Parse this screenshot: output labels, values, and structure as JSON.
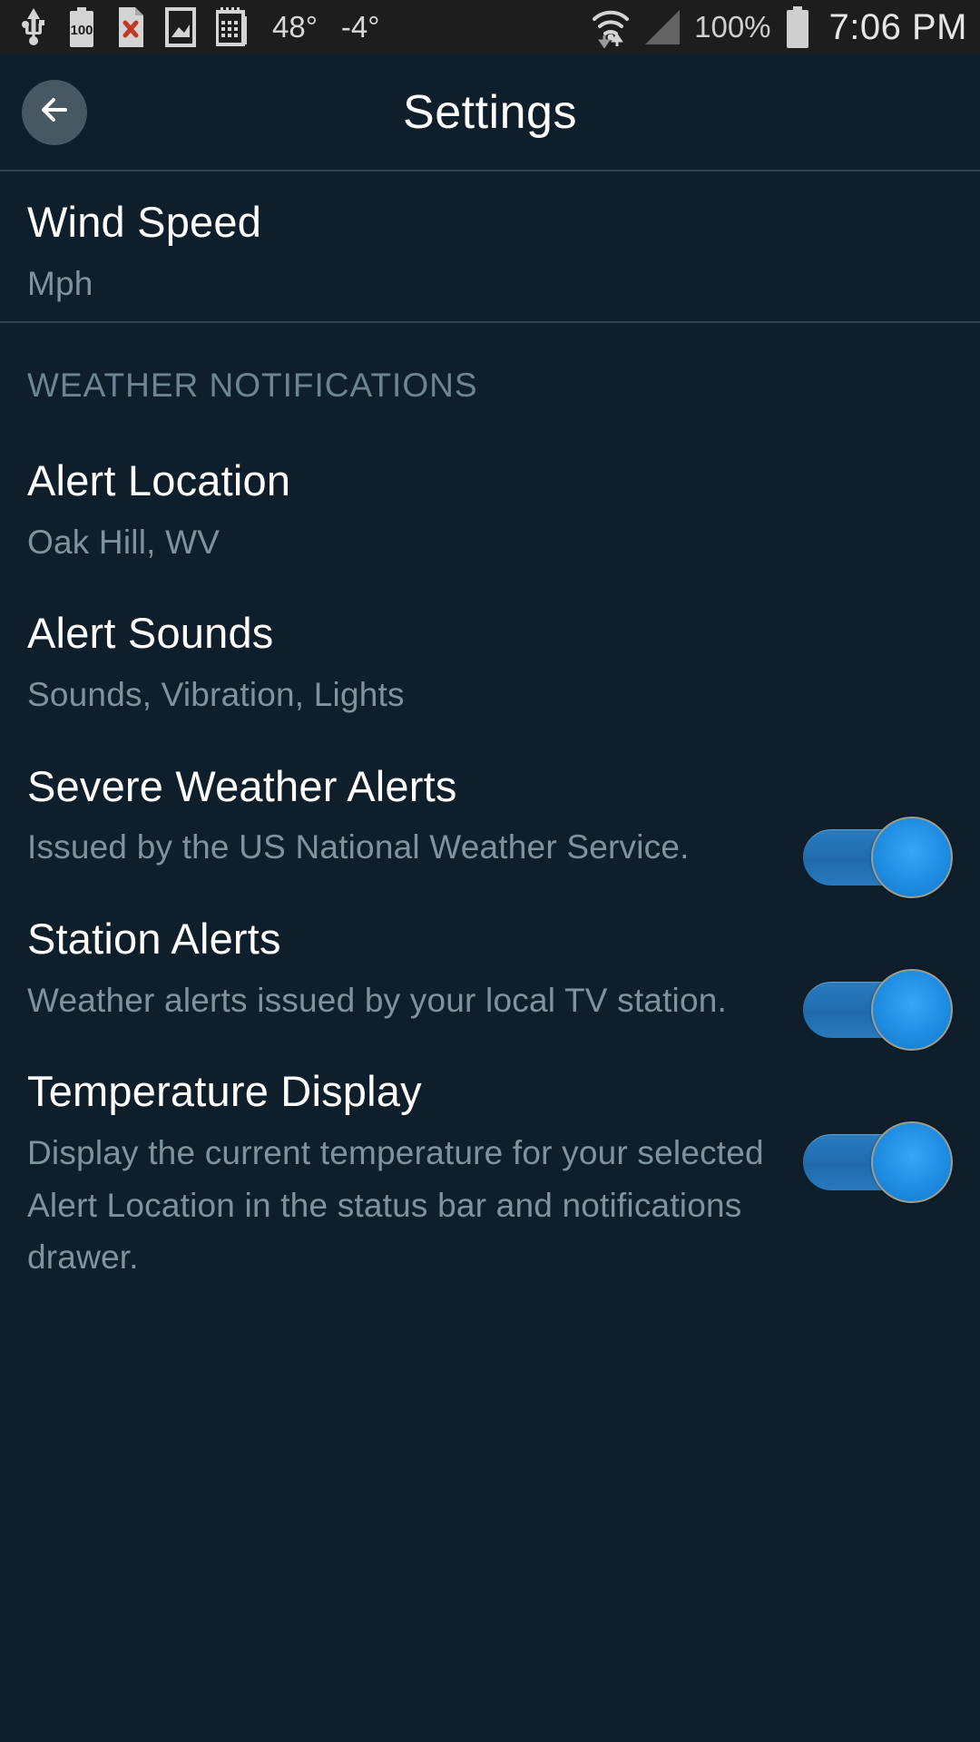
{
  "statusbar": {
    "icons_left": [
      "usb-icon",
      "battery-100-icon",
      "document-error-icon",
      "photo-icon",
      "calendar-icon"
    ],
    "temp_high": "48°",
    "temp_low": "-4°",
    "icons_right": [
      "wifi-icon",
      "signal-icon"
    ],
    "battery_percent": "100%",
    "battery_icon": "battery-icon",
    "time": "7:06 PM"
  },
  "header": {
    "back_icon": "back-arrow-icon",
    "title": "Settings"
  },
  "settings": {
    "wind_speed": {
      "title": "Wind Speed",
      "subtitle": "Mph"
    },
    "section_label": "WEATHER NOTIFICATIONS",
    "rows": [
      {
        "title": "Alert Location",
        "subtitle": "Oak Hill, WV",
        "has_toggle": false
      },
      {
        "title": "Alert Sounds",
        "subtitle": "Sounds, Vibration, Lights",
        "has_toggle": false
      },
      {
        "title": "Severe Weather Alerts",
        "subtitle": "Issued by the US National Weather Service.",
        "has_toggle": true,
        "toggle_state": "on"
      },
      {
        "title": "Station Alerts",
        "subtitle": "Weather alerts issued by your local TV station.",
        "has_toggle": true,
        "toggle_state": "on"
      },
      {
        "title": "Temperature Display",
        "subtitle": "Display the current temperature for your selected Alert Location in the status bar and notifications drawer.",
        "has_toggle": true,
        "toggle_state": "on"
      }
    ]
  },
  "colors": {
    "background": "#0e1f2b",
    "statusbar_bg": "#1d1d1d",
    "divider": "#2b4354",
    "title_text": "#ffffff",
    "subtitle_text": "#7f939e",
    "section_text": "#6d8593",
    "toggle_track": "#1f6aad",
    "toggle_thumb": "#1e8de2",
    "back_circle": "#475863"
  }
}
